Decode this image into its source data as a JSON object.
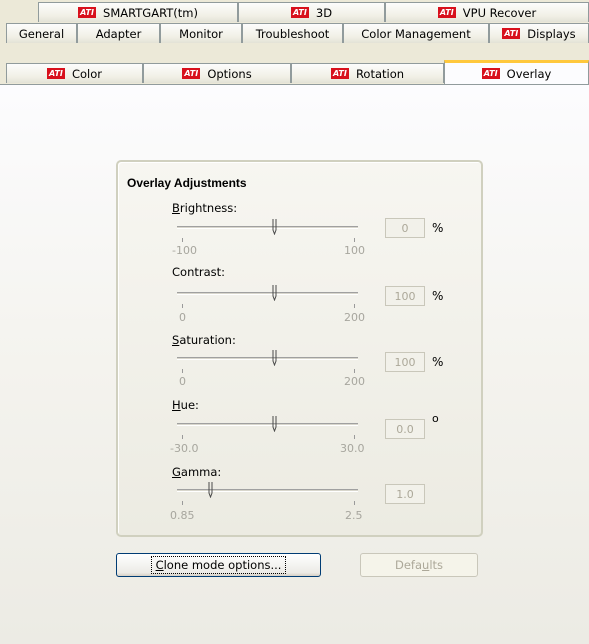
{
  "tabs_row1": [
    {
      "label": "SMARTGART(tm)",
      "ati": true
    },
    {
      "label": "3D",
      "ati": true
    },
    {
      "label": "VPU Recover",
      "ati": true
    }
  ],
  "tabs_row2": [
    {
      "label": "General"
    },
    {
      "label": "Adapter"
    },
    {
      "label": "Monitor"
    },
    {
      "label": "Troubleshoot"
    },
    {
      "label": "Color Management"
    },
    {
      "label": "Displays",
      "ati": true
    }
  ],
  "tabs_row3": [
    {
      "label": "Color",
      "ati": true
    },
    {
      "label": "Options",
      "ati": true
    },
    {
      "label": "Rotation",
      "ati": true
    },
    {
      "label": "Overlay",
      "ati": true,
      "active": true
    }
  ],
  "ati_logo_text": "ATI",
  "group_title": "Overlay Adjustments",
  "sliders": {
    "brightness": {
      "mnemonic": "B",
      "rest": "rightness:",
      "min": "-100",
      "max": "100",
      "value": "0",
      "unit": "%",
      "position": 0.5
    },
    "contrast": {
      "mnemonic": "",
      "rest": "Contrast:",
      "min": "0",
      "max": "200",
      "value": "100",
      "unit": "%",
      "position": 0.5
    },
    "saturation": {
      "mnemonic": "S",
      "rest": "aturation:",
      "min": "0",
      "max": "200",
      "value": "100",
      "unit": "%",
      "position": 0.5
    },
    "hue": {
      "mnemonic": "H",
      "rest": "ue:",
      "min": "-30.0",
      "max": "30.0",
      "value": "0.0",
      "unit": "o",
      "position": 0.5
    },
    "gamma": {
      "mnemonic": "G",
      "rest": "amma:",
      "min": "0.85",
      "max": "2.5",
      "value": "1.0",
      "unit": "",
      "position": 0.1
    }
  },
  "buttons": {
    "clone_mnemonic": "C",
    "clone_rest": "lone mode options...",
    "defaults_pre": "Defa",
    "defaults_mnemonic": "u",
    "defaults_post": "lts"
  }
}
